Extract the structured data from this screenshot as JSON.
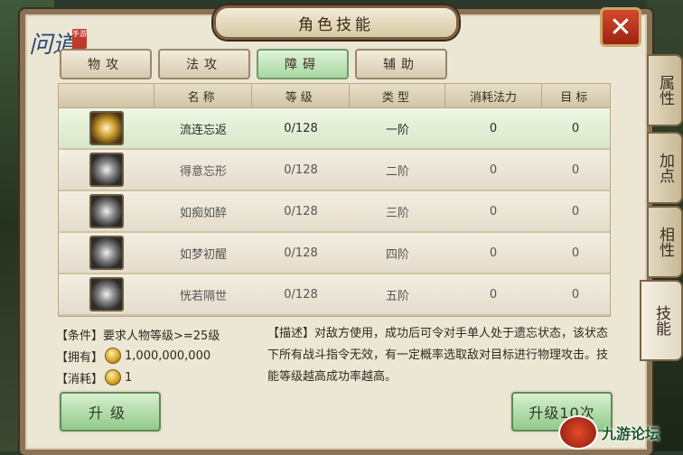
{
  "title": "角色技能",
  "logo": {
    "seal": "手游",
    "calli": "问道"
  },
  "tabs": [
    {
      "label": "物攻",
      "active": false
    },
    {
      "label": "法攻",
      "active": false
    },
    {
      "label": "障碍",
      "active": true
    },
    {
      "label": "辅助",
      "active": false
    }
  ],
  "side_tabs": [
    {
      "label": "属性"
    },
    {
      "label": "加点"
    },
    {
      "label": "相性"
    },
    {
      "label": "技能",
      "active": true
    }
  ],
  "table": {
    "headers": [
      "",
      "名称",
      "等级",
      "类型",
      "消耗法力",
      "目标"
    ],
    "rows": [
      {
        "name": "流连忘返",
        "level": "0/128",
        "type": "一阶",
        "cost": "0",
        "target": "0",
        "icon": "gold-swirl-icon"
      },
      {
        "name": "得意忘形",
        "level": "0/128",
        "type": "二阶",
        "cost": "0",
        "target": "0",
        "icon": "white-swirl-icon"
      },
      {
        "name": "如痴如醉",
        "level": "0/128",
        "type": "三阶",
        "cost": "0",
        "target": "0",
        "icon": "ornate-mask-icon"
      },
      {
        "name": "如梦初醒",
        "level": "0/128",
        "type": "四阶",
        "cost": "0",
        "target": "0",
        "icon": "sparkle-burst-icon"
      },
      {
        "name": "恍若隔世",
        "level": "0/128",
        "type": "五阶",
        "cost": "0",
        "target": "0",
        "icon": "light-burst-icon"
      }
    ]
  },
  "info": {
    "condition": "【条件】要求人物等级>=25级",
    "owned_label": "【拥有】",
    "owned_value": "1,000,000,000",
    "cost_label": "【消耗】",
    "cost_value": "1"
  },
  "description": "【描述】对敌方使用，成功后可令对手单人处于遗忘状态，该状态下所有战斗指令无效，有一定概率选取敌对目标进行物理攻击。技能等级越高成功率越高。",
  "buttons": {
    "upgrade": "升级",
    "upgrade10": "升级10次"
  },
  "watermark": "九游论坛",
  "colors": {
    "active_tab": "#a7d7a2",
    "close": "#c0392b"
  }
}
